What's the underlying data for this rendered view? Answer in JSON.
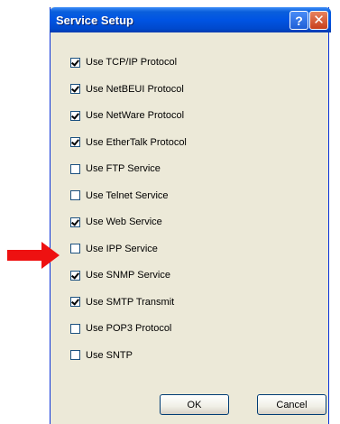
{
  "window": {
    "title": "Service Setup",
    "help_glyph": "?",
    "close_glyph": "✕"
  },
  "options": [
    {
      "label": "Use TCP/IP Protocol",
      "checked": true
    },
    {
      "label": "Use NetBEUI Protocol",
      "checked": true
    },
    {
      "label": "Use NetWare Protocol",
      "checked": true
    },
    {
      "label": "Use EtherTalk Protocol",
      "checked": true
    },
    {
      "label": "Use FTP Service",
      "checked": false
    },
    {
      "label": "Use Telnet Service",
      "checked": false
    },
    {
      "label": "Use Web Service",
      "checked": true
    },
    {
      "label": "Use IPP Service",
      "checked": false
    },
    {
      "label": "Use SNMP Service",
      "checked": true
    },
    {
      "label": "Use SMTP Transmit",
      "checked": true
    },
    {
      "label": "Use POP3 Protocol",
      "checked": false
    },
    {
      "label": "Use SNTP",
      "checked": false
    }
  ],
  "buttons": {
    "ok_label": "OK",
    "cancel_label": "Cancel"
  },
  "annotation": {
    "arrow_color": "#ee1111",
    "points_to": "Use IPP Service"
  },
  "colors": {
    "titlebar": "#0054e3",
    "dialog_bg": "#ece9d8"
  }
}
